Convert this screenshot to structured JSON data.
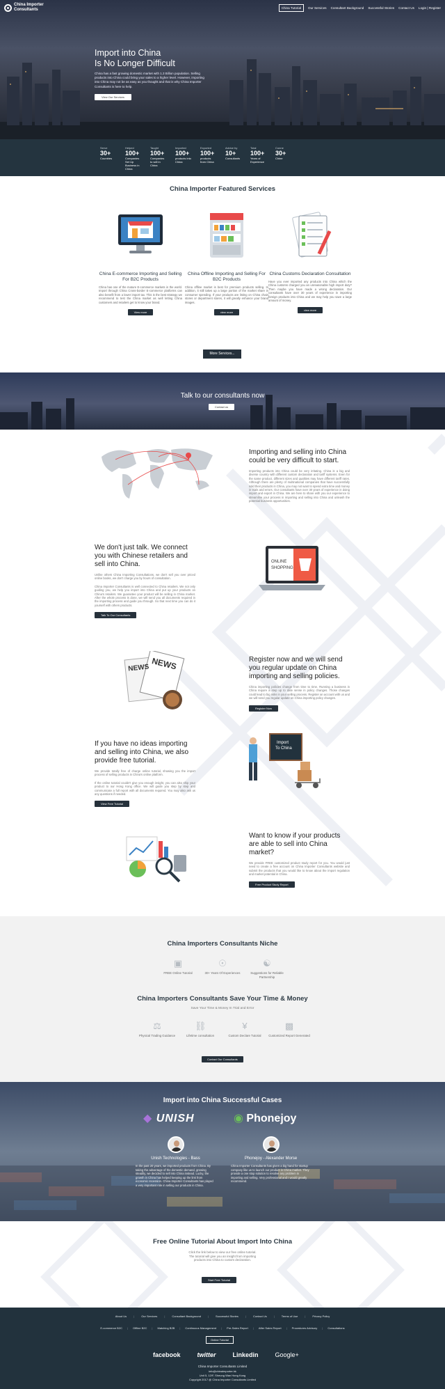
{
  "nav": {
    "logo_line1": "China Importer",
    "logo_line2": "Consultants",
    "items": [
      "China Tutorial",
      "Our Services",
      "Consultant Background",
      "Successful Stories",
      "Contact Us",
      "Login",
      "Register"
    ]
  },
  "hero": {
    "title_line1": "Import into China",
    "title_line2": "Is No Longer Difficult",
    "body": "China has a fast growing domestic market with 1.3 Billion population. Selling products into China could bring your sales to a higher level. However, importing into China may not be as easy as you thought and that is why China Importer Consultants is here to help.",
    "button": "View Our Services"
  },
  "stats": [
    {
      "lbl": "Serve",
      "num": "30+",
      "sub": "Countries"
    },
    {
      "lbl": "Helped",
      "num": "100+",
      "sub": "Companies Set Up Business in China"
    },
    {
      "lbl": "Taught",
      "num": "100+",
      "sub": "Companies to sell in China"
    },
    {
      "lbl": "Imported",
      "num": "100+",
      "sub": "products into China"
    },
    {
      "lbl": "Exported",
      "num": "100+",
      "sub": "products from China"
    },
    {
      "lbl": "Advice by",
      "num": "10+",
      "sub": "Consultants"
    },
    {
      "lbl": "Total",
      "num": "100+",
      "sub": "Years of Experience"
    },
    {
      "lbl": "Conne",
      "num": "30+",
      "sub": "Chine"
    }
  ],
  "featured": {
    "title": "China Importer Featured Services",
    "items": [
      {
        "title": "China E-commerce Importing and Selling For B2C Products",
        "body": "China has one of the mature E-commerce markets in the world. Import through China Cross-border E-commerce platforms can also benefit from a lower import tax. This is the best strategy we recommend to test the China market as well letting China customers and retailers get to know your brand.",
        "button": "View more"
      },
      {
        "title": "China Offline Importing and Selling For B2C Products",
        "body": "China offline market is best for premium products selling. In addition, it still takes up a large portion of the market share in consumer spending. If your products are listing on China chain stores or department stores, it will greatly enhance your brand images.",
        "button": "view more"
      },
      {
        "title": "China Customs Declaration Consultation",
        "body": "Have you ever imported any products into China which the China customs charged you an unreasonable high import duty? Then maybe you have made a wrong declaration. Our consultants have over 30 years of experience in importing foreign products into China and we may help you save a large amount of money.",
        "button": "view more"
      }
    ],
    "more_button": "More Services..."
  },
  "talk": {
    "title": "Talk to our consultants now",
    "button": "Contact us"
  },
  "rows": [
    {
      "title": "Importing and selling into China could be very difficult to start.",
      "body": "Importing products into China could be very irritating. China is a big and diverse country with different custom declaration and tariff systems. Even for the same product, different sizes and qualities may have different tariff rates. Although there are plenty of multinational companies that have successfully sold their products in China, you may not want to spend extra time and money in trials and errors. Our consultants have over 30 years of experience in doing import and export in China. We are here to share with you our experience to streamline your process in importing and selling into China and unleash the potential business opportunities."
    },
    {
      "title": "We don't just talk. We connect you with Chinese retailers and sell into China.",
      "body1": "Unlike others China Importing Consultations, we don't sell you over priced online books, we don't charge you by hours of consultation.",
      "body2": "China Importer Consultants is well connected to China retailers. We not only guiding you, we help you import into China and put up your products on China's retailers. We guarantee your product will be selling in China market. After the whole process is done, we will send you all documents required in the importing process and guide you through. So that next time you can do it yourself with others products.",
      "button": "Talk To Our Consultants"
    },
    {
      "title": "Register now and we will send you regular update on China importing and selling policies.",
      "body": "China importing policies change from time to time. Running a business in China require a step up to date sense in policy changes. Those changes could lead to big risks in your selling process. Register an account with us and we will send you regular update on China importing policy changes.",
      "button": "Register Now"
    },
    {
      "title": "If you have no ideas importing and selling into China, we also provide free tutorial.",
      "body1": "We provide totally free of charge online tutorial, showing you the import process of selling products in China's online platform.",
      "body2": "If the online tutorial couldn't give you enough insight, you can also ship your product to our Hong Kong office. We will guide you step by step and communicate a full report with all documents required. You may also ask us any questions if needed.",
      "button": "View Free Tutorial"
    },
    {
      "title": "Want to know if your products are able to sell into China market?",
      "body": "We provide FREE customized product study report for you. You would just need to create a free account on China Importer Consultants website and submit the products that you would like to know about the import regulation and market potential in China.",
      "button": "Free Product Study Report"
    }
  ],
  "illus": {
    "news": "NEWS",
    "online": "ONLINE",
    "shopping": "SHOPPING",
    "import": "Import",
    "to_china": "To China"
  },
  "niche": {
    "title": "China Importers Consultants Niche",
    "items": [
      "FREE Online Tutorial",
      "30+ Years Of Experiences",
      "Suggestions for Reliable Partnership"
    ],
    "save_title": "China Importers Consultants Save Your Time & Money",
    "save_sub": "Save Your Time & Money In Trial and Error",
    "save_items": [
      "Physical Trading Guidance",
      "Lifetime consultation",
      "Custom Declare Tutorial",
      "Customized Report Generated"
    ],
    "button": "Contact Our Consultants"
  },
  "cases": {
    "title": "Import into China Successful Cases",
    "brand1": "UNISH",
    "brand2": "Phonejoy",
    "items": [
      {
        "name": "Unish Technologies - Bass",
        "body": "In the past 20 years, we imported products from China. By taking the advantage of the domestic demand, growing steadily, we decided to sell into China instead. Lucky, the growth in China has helped keeping up the link from economic recession. China Importer Consultants has played a very important role in selling our products in China."
      },
      {
        "name": "Phonejoy - Alexander Morse",
        "body": "China Importer Consultants has given a big hand for startup company like us to launch our product in China market. They provide a one stop solution to resolve any problem in importing and selling. Very professional and I would greatly recommend."
      }
    ]
  },
  "tutorial": {
    "title": "Free Online Tutorial About Import Into China",
    "body": "Click the link below to view our free online tutorial. The tutorial will give you an insight from importing products into China to custom declaration.",
    "button": "Start Free Tutorial"
  },
  "footer": {
    "row1": [
      "About Us",
      "Our Services",
      "Consultant Background",
      "Successful Stories",
      "Contact Us",
      "Terms of Use",
      "Privacy Policy"
    ],
    "row2": [
      "E-commerce B2C",
      "Offline B2C",
      "Matching B2B",
      "Continuous Management",
      "Pre-Sales Report",
      "After Sales Report",
      "Procedures Advisory",
      "Consultations"
    ],
    "button": "Online Tutorial",
    "social": [
      "facebook",
      "twitter",
      "Linkedin",
      "Google+"
    ],
    "company": "China Importer Consultants Limited",
    "email": "info@chinaimporter.hk",
    "address": "Unit 5, 12/F, Sheung Wan Hong Kong",
    "copyright": "Copyright 2017 @ China Importer Consultants Limited"
  }
}
